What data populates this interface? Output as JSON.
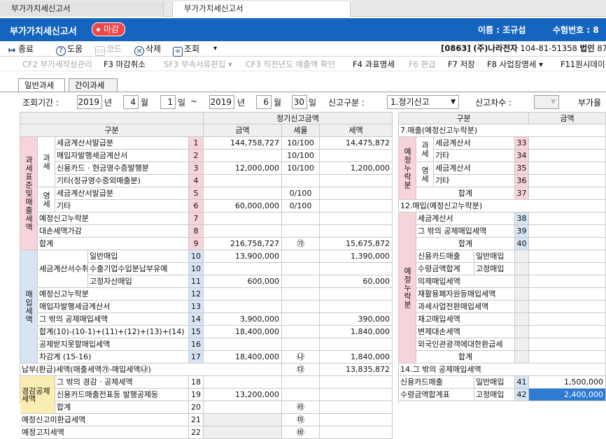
{
  "window_tabs": [
    "부가가치세신고서",
    "부가가치세신고서"
  ],
  "header": {
    "title": "부가가치세신고서",
    "status_badge": "마감",
    "name_label": "이름 : 조규섭",
    "exam_label": "수험번호 : 8"
  },
  "toolbar": {
    "exit": "종료",
    "help": "도움",
    "code": "코드",
    "delete": "삭제",
    "search": "조회",
    "more": "▾"
  },
  "company": {
    "code": "[0863]",
    "name": "(주)나라전자",
    "bizno": "104-81-51358",
    "type": "법인",
    "tail": "87"
  },
  "fkeys": [
    "CF2 부가세작성관리",
    "F3 마감취소",
    "SF3 부속서류편집 ▾",
    "CF3 직전년도 매출액 확인",
    "F4 과표명세",
    "F6 환급",
    "F7 저장",
    "F8 사업장명세 ▾",
    "F11원시데이"
  ],
  "subtabs": [
    "일반과세",
    "간이과세"
  ],
  "period": {
    "label": "조회기간 :",
    "y1": "2019",
    "m1": "4",
    "d1": "1",
    "y2": "2019",
    "m2": "6",
    "d2": "30",
    "year": "년",
    "month": "월",
    "day": "일",
    "tilde": "~",
    "type_label": "신고구분 :",
    "type_value": "1.정기신고",
    "count_label": "신고차수 :",
    "right_label": "부가율"
  },
  "left": {
    "top_header": "정기신고금액",
    "col_headers": [
      "구분",
      "금액",
      "세율",
      "세액"
    ],
    "groups": {
      "tax_base": "과세표준및매출세액",
      "tax_sub": "과세",
      "zero_sub": "영세",
      "purchase": "매입세액",
      "inv_sub": "세금계산서수취분",
      "reduce": "경감공제세액"
    },
    "rows": [
      {
        "label": "세금계산서발급분",
        "no": "1",
        "amount": "144,758,727",
        "rate": "10/100",
        "tax": "14,475,872"
      },
      {
        "label": "매입자발행세금계산서",
        "no": "2",
        "amount": "",
        "rate": "10/100",
        "tax": ""
      },
      {
        "label": "신용카드 · 현금영수증발행분",
        "no": "3",
        "amount": "12,000,000",
        "rate": "10/100",
        "tax": "1,200,000"
      },
      {
        "label": "기타(정규영수증외매출분)",
        "no": "4",
        "amount": "",
        "rate": "",
        "tax": ""
      },
      {
        "label": "세금계산서발급분",
        "no": "5",
        "amount": "",
        "rate": "0/100",
        "tax": ""
      },
      {
        "label": "기타",
        "no": "6",
        "amount": "60,000,000",
        "rate": "0/100",
        "tax": ""
      },
      {
        "label": "예정신고누락분",
        "no": "7",
        "amount": "",
        "rate": "",
        "tax": ""
      },
      {
        "label": "대손세액가감",
        "no": "8",
        "amount": "",
        "rate": "",
        "tax": ""
      },
      {
        "label": "합계",
        "no": "9",
        "amount": "216,758,727",
        "rate": "㉮",
        "tax": "15,675,872"
      },
      {
        "label": "일반매입",
        "no": "10",
        "amount": "13,900,000",
        "rate": "",
        "tax": "1,390,000"
      },
      {
        "label": "수출기업수입분납부유예",
        "no": "10",
        "amount": "",
        "rate": "",
        "tax": ""
      },
      {
        "label": "고정자산매입",
        "no": "11",
        "amount": "600,000",
        "rate": "",
        "tax": "60,000"
      },
      {
        "label": "예정신고누락분",
        "no": "12",
        "amount": "",
        "rate": "",
        "tax": ""
      },
      {
        "label": "매입자발행세금계산서",
        "no": "13",
        "amount": "",
        "rate": "",
        "tax": ""
      },
      {
        "label": "그 밖의 공제매입세액",
        "no": "14",
        "amount": "3,900,000",
        "rate": "",
        "tax": "390,000"
      },
      {
        "label": "합계(10)-(10-1)+(11)+(12)+(13)+(14)",
        "no": "15",
        "amount": "18,400,000",
        "rate": "",
        "tax": "1,840,000"
      },
      {
        "label": "공제받지못할매입세액",
        "no": "16",
        "amount": "",
        "rate": "",
        "tax": ""
      },
      {
        "label": "차감계 (15-16)",
        "no": "17",
        "amount": "18,400,000",
        "rate": "㉯",
        "tax": "1,840,000"
      }
    ],
    "payable": {
      "label": "납부(환급)세액(매출세액㉮-매입세액㉯)",
      "rate": "㉰",
      "tax": "13,835,872"
    },
    "reduce_rows": [
      {
        "label": "그 밖의 경감 · 공제세액",
        "no": "18",
        "amount": "",
        "rate": ""
      },
      {
        "label": "신용카드매출전표등 발행공제등",
        "no": "19",
        "amount": "13,200,000",
        "rate": ""
      },
      {
        "label": "합계",
        "no": "20",
        "amount": "",
        "rate": "㉱"
      }
    ],
    "bottom_rows": [
      {
        "label": "예정신고미환급세액",
        "no": "21",
        "rate": "㉲"
      },
      {
        "label": "예정고지세액",
        "no": "22",
        "rate": "㉳"
      }
    ]
  },
  "right": {
    "col_headers": [
      "구분",
      "금액"
    ],
    "sec7": "7.매출(예정신고누락분)",
    "sec7_group": "예정누락분",
    "sec7_tax": "과세",
    "sec7_zero": "영세",
    "sec7_rows": [
      {
        "label": "세금계산서",
        "no": "33"
      },
      {
        "label": "기타",
        "no": "34"
      },
      {
        "label": "세금계산서",
        "no": "35"
      },
      {
        "label": "기타",
        "no": "36"
      },
      {
        "label": "합계",
        "no": "37"
      }
    ],
    "sec12": "12.매입(예정신고누락분)",
    "sec12_group": "예정누락분",
    "sec12_rows": [
      {
        "label": "세금계산서",
        "no": "38"
      },
      {
        "label": "그 밖의 공제매입세액",
        "no": "39"
      },
      {
        "label": "합계",
        "no": "40"
      }
    ],
    "card_label1": "신용카드매출",
    "card_label2": "수령금액합계",
    "card_sub1": "일반매입",
    "card_sub2": "고정매입",
    "sec12_more": [
      "의제매입세액",
      "재활용폐자원등매입세액",
      "과세사업전환매입세액",
      "재고매입세액",
      "변제대손세액",
      "외국인관광객에대한환급세",
      "합계"
    ],
    "sec14": "14.그 밖의 공제매입세액",
    "sec14_label1": "신용카드매출",
    "sec14_label2": "수령금액합계표",
    "sec14_rows": [
      {
        "label": "일반매입",
        "no": "41",
        "amount": "1,500,000"
      },
      {
        "label": "고정매입",
        "no": "42",
        "amount": "2,400,000"
      }
    ]
  },
  "colors": {
    "title_bg": "#1565c0",
    "badge": "#f04848",
    "pink": "#f6d4da",
    "blue": "#d6e4f3",
    "yellow": "#fbedb1",
    "selected": "#2e7bd2"
  }
}
